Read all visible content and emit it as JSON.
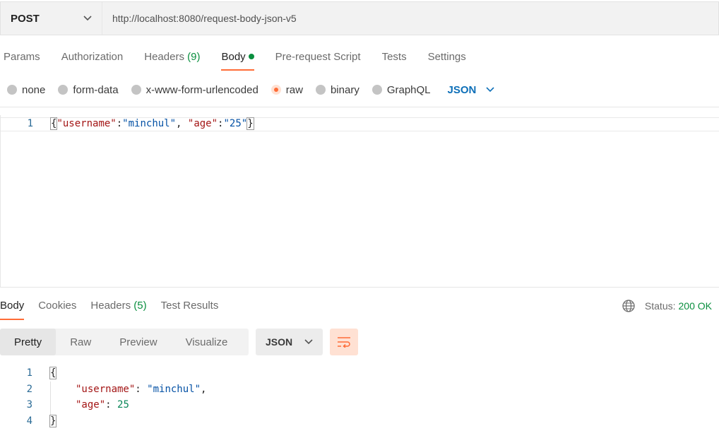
{
  "request": {
    "method": "POST",
    "url": "http://localhost:8080/request-body-json-v5"
  },
  "request_tabs": [
    {
      "label": "Params"
    },
    {
      "label": "Authorization"
    },
    {
      "label": "Headers",
      "count": "(9)"
    },
    {
      "label": "Body",
      "active": true
    },
    {
      "label": "Pre-request Script"
    },
    {
      "label": "Tests"
    },
    {
      "label": "Settings"
    }
  ],
  "body_types": {
    "options": [
      "none",
      "form-data",
      "x-www-form-urlencoded",
      "raw",
      "binary",
      "GraphQL"
    ],
    "selected": "raw",
    "format": "JSON"
  },
  "request_body": {
    "line_number": "1",
    "open_brace": "{",
    "key1": "\"username\"",
    "colon1": ":",
    "value1": "\"minchul\"",
    "comma": ", ",
    "key2": "\"age\"",
    "colon2": ":",
    "value2": "\"25\"",
    "close_brace": "}"
  },
  "response_tabs": [
    {
      "label": "Body",
      "active": true
    },
    {
      "label": "Cookies"
    },
    {
      "label": "Headers",
      "count": "(5)"
    },
    {
      "label": "Test Results"
    }
  ],
  "status": {
    "label": "Status:",
    "code": "200 OK"
  },
  "view_modes": [
    "Pretty",
    "Raw",
    "Preview",
    "Visualize"
  ],
  "view_mode_selected": "Pretty",
  "response_format": "JSON",
  "response_body": {
    "line_numbers": [
      "1",
      "2",
      "3",
      "4"
    ],
    "open_brace": "{",
    "key1": "\"username\"",
    "value1": "\"minchul\"",
    "key2": "\"age\"",
    "value2": "25",
    "close_brace": "}"
  },
  "colors": {
    "accent": "#ff6c37",
    "success": "#0a8f3f",
    "link": "#0d6fb8"
  }
}
